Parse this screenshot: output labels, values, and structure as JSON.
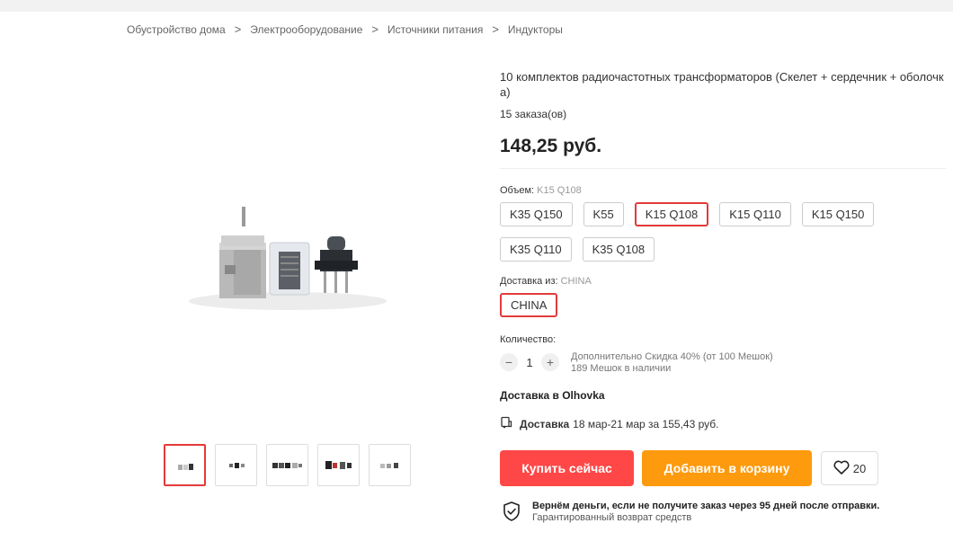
{
  "breadcrumb": {
    "items": [
      "Обустройство дома",
      "Электрооборудование",
      "Источники питания",
      "Индукторы"
    ],
    "separator": ">"
  },
  "gallery": {
    "main_image": "transformer-parts-photo",
    "thumbnail_count": 5
  },
  "product": {
    "title": "10 комплектов радиочастотных трансформаторов (Скелет + сердечник + оболочк а)",
    "orders": "15 заказа(ов)",
    "price": "148,25 руб."
  },
  "volume": {
    "label": "Объем:",
    "selected": "K15 Q108",
    "options": [
      "K35 Q150",
      "K55",
      "K15 Q108",
      "K15 Q110",
      "K15 Q150",
      "K35 Q110",
      "K35 Q108"
    ],
    "selected_index": 2
  },
  "ship_from": {
    "label": "Доставка из:",
    "selected": "CHINA",
    "option": "CHINA"
  },
  "quantity": {
    "label": "Количество:",
    "minus": "−",
    "plus": "+",
    "value": "1",
    "discount": "Дополнительно Скидка 40% (от 100 Мешок)",
    "stock": "189 Мешок в наличии"
  },
  "delivery": {
    "title": "Доставка в Olhovka",
    "label": "Доставка",
    "details": "18 мар-21 мар за 155,43 руб."
  },
  "actions": {
    "buy_now": "Купить сейчас",
    "add_to_cart": "Добавить в корзину",
    "wishlist_count": "20"
  },
  "guarantee": {
    "title": "Вернём деньги, если не получите заказ через 95 дней после отправки.",
    "subtitle": "Гарантированный возврат средств"
  },
  "colors": {
    "accent_red": "#ff4747",
    "accent_orange": "#fe9a0d",
    "selected_border": "#e43a3a"
  }
}
